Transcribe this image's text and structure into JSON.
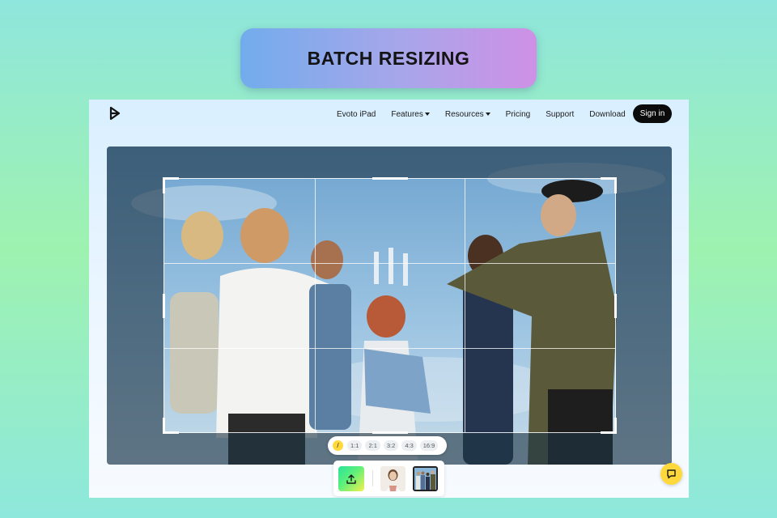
{
  "banner": {
    "title": "BATCH RESIZING"
  },
  "nav": {
    "logo_icon": "evoto-logo-icon",
    "links": [
      {
        "label": "Evoto iPad",
        "has_dropdown": false
      },
      {
        "label": "Features",
        "has_dropdown": true
      },
      {
        "label": "Resources",
        "has_dropdown": true
      },
      {
        "label": "Pricing",
        "has_dropdown": false
      },
      {
        "label": "Support",
        "has_dropdown": false
      },
      {
        "label": "Download",
        "has_dropdown": false
      }
    ],
    "sign_in_label": "Sign in"
  },
  "editor": {
    "crop_grid": "3x3",
    "aspect_ratios": {
      "free_icon": "/",
      "options": [
        "1:1",
        "2:1",
        "3:2",
        "4:3",
        "16:9"
      ]
    }
  },
  "tray": {
    "upload_icon": "upload-icon",
    "thumbnails": [
      {
        "name": "portrait-woman",
        "selected": false
      },
      {
        "name": "group-toast-photo",
        "selected": true
      }
    ]
  },
  "chat": {
    "icon": "chat-icon"
  },
  "colors": {
    "accent_yellow": "#ffd93c",
    "signin_bg": "#0b0b0b",
    "banner_gradient_start": "#72acec",
    "banner_gradient_end": "#cf90e6"
  }
}
